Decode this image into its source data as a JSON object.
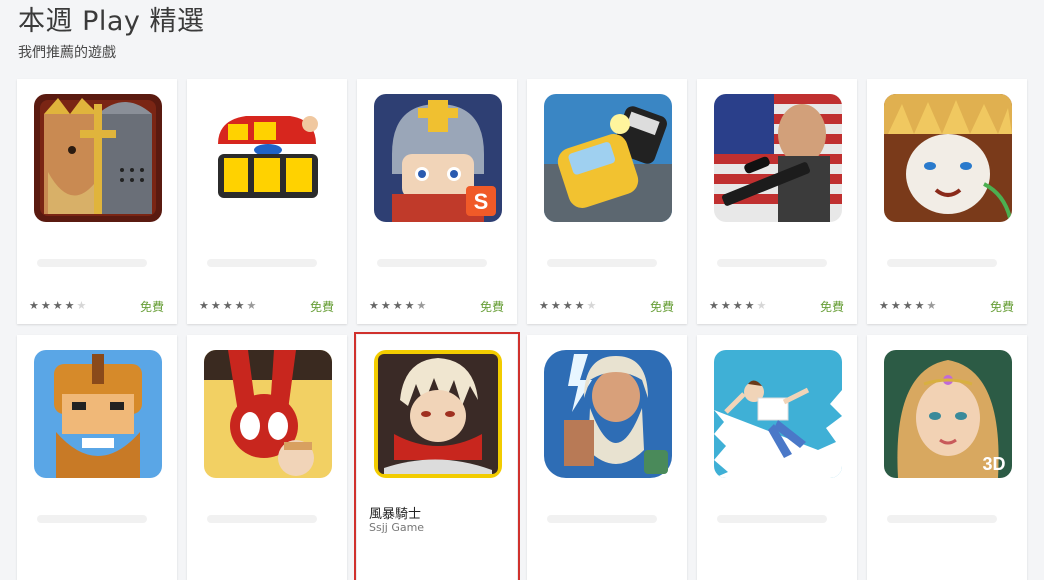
{
  "header": {
    "title": "本週 Play 精選",
    "subtitle": "我們推薦的遊戲"
  },
  "row1": [
    {
      "icon": "castle-king-knight-icon",
      "rating": [
        1,
        1,
        1,
        1,
        0
      ],
      "price": "免費",
      "colors": [
        "#5a1a10",
        "#c9a23a"
      ]
    },
    {
      "icon": "boss-ko-logo-icon",
      "rating": [
        1,
        1,
        1,
        1,
        0.5
      ],
      "price": "免費",
      "colors": [
        "#ffffff",
        "#2b2b2b"
      ]
    },
    {
      "icon": "armored-hero-icon",
      "rating": [
        1,
        1,
        1,
        1,
        0.5
      ],
      "price": "免費",
      "colors": [
        "#2e3f73",
        "#e74c3c"
      ]
    },
    {
      "icon": "taxi-car-chase-icon",
      "rating": [
        1,
        1,
        1,
        1,
        0
      ],
      "price": "免費",
      "colors": [
        "#3a86c4",
        "#f2c230"
      ]
    },
    {
      "icon": "sniper-soldier-icon",
      "rating": [
        1,
        1,
        1,
        1,
        0
      ],
      "price": "免費",
      "colors": [
        "#b63232",
        "#3b3b3b"
      ]
    },
    {
      "icon": "tiger-warrior-icon",
      "rating": [
        1,
        1,
        1,
        1,
        0.5
      ],
      "price": "免費",
      "colors": [
        "#e0b050",
        "#6a3c1c"
      ]
    }
  ],
  "row2": [
    {
      "icon": "dwarf-warrior-icon",
      "colors": [
        "#5aa6e6",
        "#d68a2a"
      ]
    },
    {
      "icon": "spider-hero-icon",
      "colors": [
        "#f2d063",
        "#c8261e"
      ]
    },
    {
      "icon": "storm-knight-icon",
      "colors": [
        "#3a2a26",
        "#f2cc00"
      ],
      "title": "風暴騎士",
      "developer": "Ssjj Game",
      "highlighted": true
    },
    {
      "icon": "zeus-god-icon",
      "colors": [
        "#2e6db5",
        "#e8e2d0"
      ]
    },
    {
      "icon": "falling-man-icon",
      "colors": [
        "#3fb0d6",
        "#ffffff"
      ]
    },
    {
      "icon": "fantasy-princess-icon",
      "colors": [
        "#2c5b45",
        "#e8c5a0"
      ],
      "badge": "3D"
    }
  ]
}
